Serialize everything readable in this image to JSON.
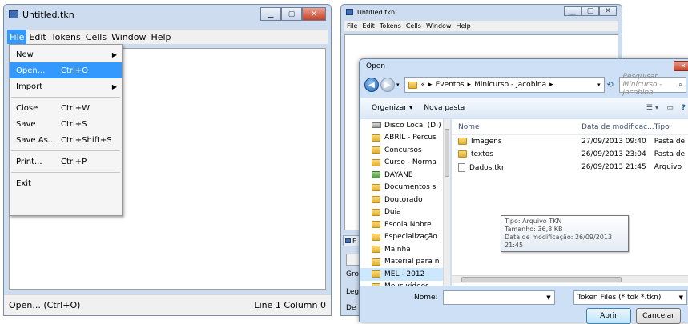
{
  "left_window": {
    "title": "Untitled.tkn",
    "menu": [
      "File",
      "Edit",
      "Tokens",
      "Cells",
      "Window",
      "Help"
    ],
    "file_menu": [
      {
        "label": "New",
        "shortcut": "",
        "submenu": true
      },
      {
        "label": "Open...",
        "shortcut": "Ctrl+O",
        "submenu": false,
        "highlighted": true
      },
      {
        "label": "Import",
        "shortcut": "",
        "submenu": true
      },
      {
        "label": "Close",
        "shortcut": "Ctrl+W",
        "submenu": false
      },
      {
        "label": "Save",
        "shortcut": "Ctrl+S",
        "submenu": false
      },
      {
        "label": "Save As...",
        "shortcut": "Ctrl+Shift+S",
        "submenu": false
      },
      {
        "label": "Print...",
        "shortcut": "Ctrl+P",
        "submenu": false
      },
      {
        "label": "Exit",
        "shortcut": "",
        "submenu": false
      }
    ],
    "status_left": "Open... (Ctrl+O)",
    "status_right": "Line 1 Column 0"
  },
  "right_window": {
    "title": "Untitled.tkn",
    "menu": [
      "File",
      "Edit",
      "Tokens",
      "Cells",
      "Window",
      "Help"
    ],
    "partial_labels": [
      "F",
      "Gro",
      "Leg",
      "De"
    ]
  },
  "open_dialog": {
    "title": "Open",
    "breadcrumb": [
      "«",
      "Eventos",
      "Minicurso - Jacobina"
    ],
    "search_placeholder": "Pesquisar Minicurso - Jacobina",
    "toolbar": {
      "organize": "Organizar ▾",
      "new_folder": "Nova pasta"
    },
    "tree": [
      {
        "label": "Disco Local (D:)",
        "icon": "drive-icon"
      },
      {
        "label": "ABRIL - Percus",
        "icon": "folder-icon"
      },
      {
        "label": "Concursos",
        "icon": "folder-icon"
      },
      {
        "label": "Curso - Norma",
        "icon": "folder-icon"
      },
      {
        "label": "DAYANE",
        "icon": "user-folder-icon"
      },
      {
        "label": "Documentos si",
        "icon": "folder-icon"
      },
      {
        "label": "Doutorado",
        "icon": "folder-icon"
      },
      {
        "label": "Duia",
        "icon": "folder-icon"
      },
      {
        "label": "Escola Nobre",
        "icon": "folder-icon"
      },
      {
        "label": "Especialização",
        "icon": "folder-icon"
      },
      {
        "label": "Mainha",
        "icon": "folder-icon"
      },
      {
        "label": "Material para n",
        "icon": "folder-icon"
      },
      {
        "label": "MEL - 2012",
        "icon": "folder-icon",
        "selected": true
      },
      {
        "label": "Meus vídeos",
        "icon": "folder-icon"
      }
    ],
    "columns": [
      "Nome",
      "Data de modificaç...",
      "Tipo"
    ],
    "files": [
      {
        "name": "Imagens",
        "date": "27/09/2013 09:40",
        "type": "Pasta de",
        "icon": "folder-icon"
      },
      {
        "name": "textos",
        "date": "26/09/2013 23:04",
        "type": "Pasta de",
        "icon": "folder-icon"
      },
      {
        "name": "Dados.tkn",
        "date": "26/09/2013 21:45",
        "type": "Arquivo",
        "icon": "file-icon"
      }
    ],
    "tooltip": [
      "Tipo: Arquivo TKN",
      "Tamanho: 36,8 KB",
      "Data de modificação: 26/09/2013 21:45"
    ],
    "filename_label": "Nome:",
    "filename_value": "",
    "filter": "Token Files (*.tok *.tkn)",
    "open_button": "Abrir",
    "cancel_button": "Cancelar"
  }
}
